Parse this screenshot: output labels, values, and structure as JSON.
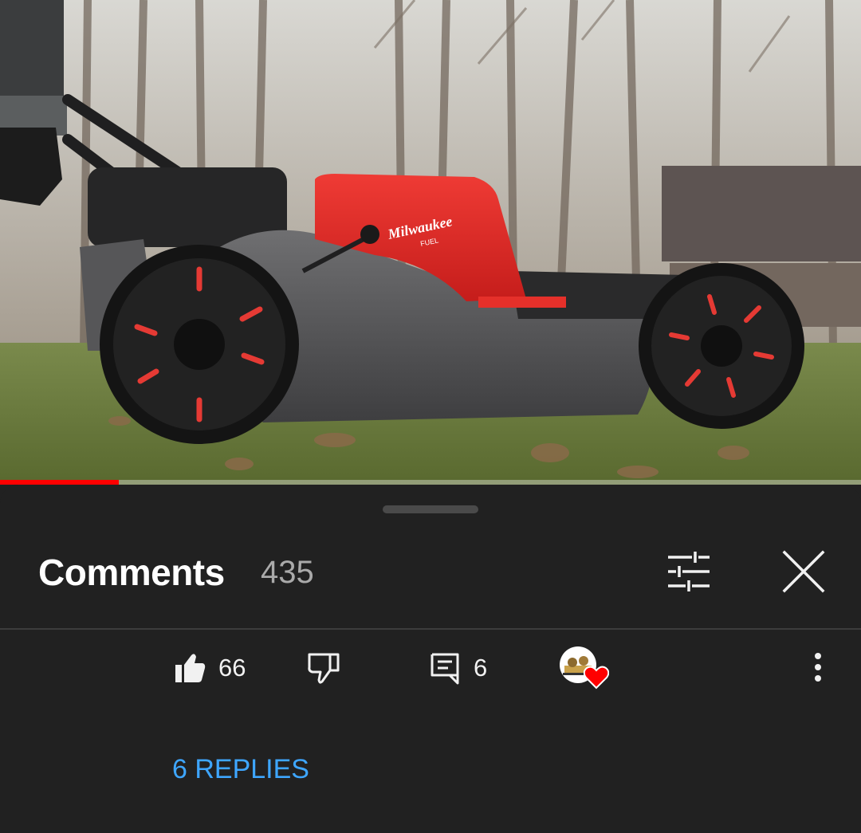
{
  "video": {
    "thumbnail": "lawn-mower-video-frame",
    "brand_text": "Milwaukee",
    "brand_sub": "FUEL",
    "progress_fraction": 0.138,
    "progress_color": "#ff0000"
  },
  "comments_panel": {
    "title": "Comments",
    "count": "435",
    "sort_icon": "tune-icon",
    "close_icon": "close-icon"
  },
  "comment": {
    "likes": "66",
    "replies_count": "6",
    "creator_heart": true,
    "replies_link": "6 REPLIES",
    "more_icon": "more-vertical-icon"
  },
  "colors": {
    "background": "#212121",
    "link": "#3ea6ff",
    "heart": "#ff0000"
  }
}
